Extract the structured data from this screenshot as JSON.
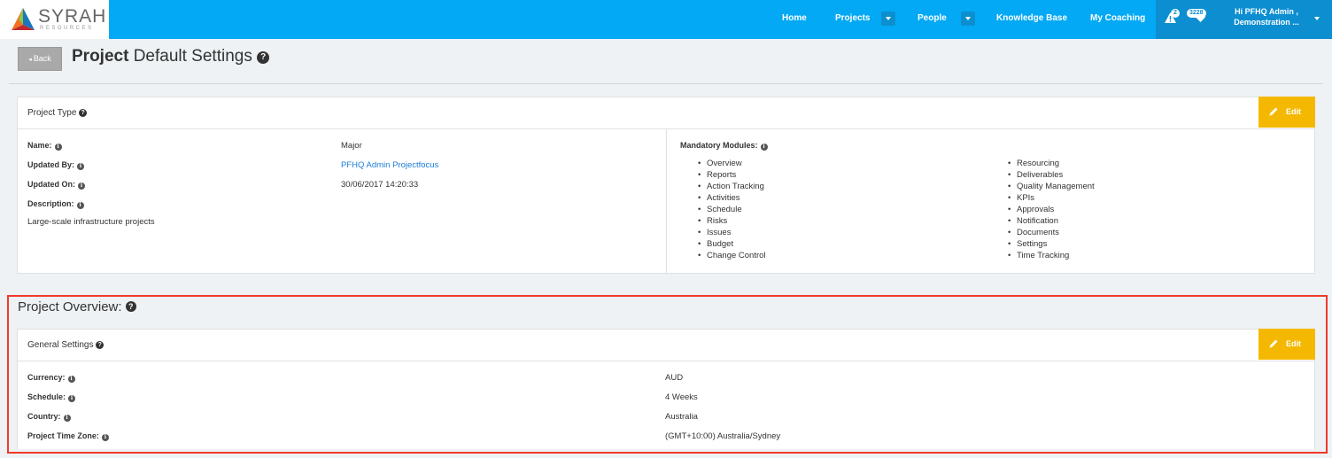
{
  "brand": {
    "name": "SYRAH",
    "sub": "RESOURCES",
    "colors": {
      "orange": "#f37021",
      "green": "#8dc63f",
      "blue": "#1d75bc",
      "red": "#c1272d"
    }
  },
  "nav": {
    "items": [
      {
        "label": "Home"
      },
      {
        "label": "Projects"
      },
      {
        "label": "People"
      },
      {
        "label": "Knowledge Base"
      },
      {
        "label": "My Coaching"
      }
    ],
    "alerts_count": "2",
    "notifications_count": "3228",
    "greeting_line1": "Hi PFHQ Admin ,",
    "greeting_line2": "Demonstration ..."
  },
  "header": {
    "back_label": "Back",
    "title_bold": "Project",
    "title_rest": "Default Settings",
    "help_glyph": "?"
  },
  "project_type": {
    "title": "Project Type",
    "edit_label": "Edit",
    "fields": {
      "name_label": "Name:",
      "name_value": "Major",
      "updated_by_label": "Updated By:",
      "updated_by_value": "PFHQ Admin Projectfocus",
      "updated_on_label": "Updated On:",
      "updated_on_value": "30/06/2017 14:20:33",
      "description_label": "Description:",
      "description_value": "Large-scale infrastructure projects"
    },
    "mandatory_modules_label": "Mandatory Modules:",
    "modules_col1": [
      "Overview",
      "Reports",
      "Action Tracking",
      "Activities",
      "Schedule",
      "Risks",
      "Issues",
      "Budget",
      "Change Control"
    ],
    "modules_col2": [
      "Resourcing",
      "Deliverables",
      "Quality Management",
      "KPIs",
      "Approvals",
      "Notification",
      "Documents",
      "Settings",
      "Time Tracking"
    ]
  },
  "project_overview": {
    "title": "Project Overview:",
    "general_settings": {
      "title": "General Settings",
      "edit_label": "Edit",
      "currency_label": "Currency:",
      "currency_value": "AUD",
      "schedule_label": "Schedule:",
      "schedule_value": "4 Weeks",
      "country_label": "Country:",
      "country_value": "Australia",
      "timezone_label": "Project Time Zone:",
      "timezone_value": "(GMT+10:00) Australia/Sydney"
    }
  },
  "icons": [
    "warning-icon",
    "heart-icon",
    "help-icon",
    "info-icon",
    "pencil-icon",
    "caret-down-icon",
    "back-arrow-icon"
  ]
}
